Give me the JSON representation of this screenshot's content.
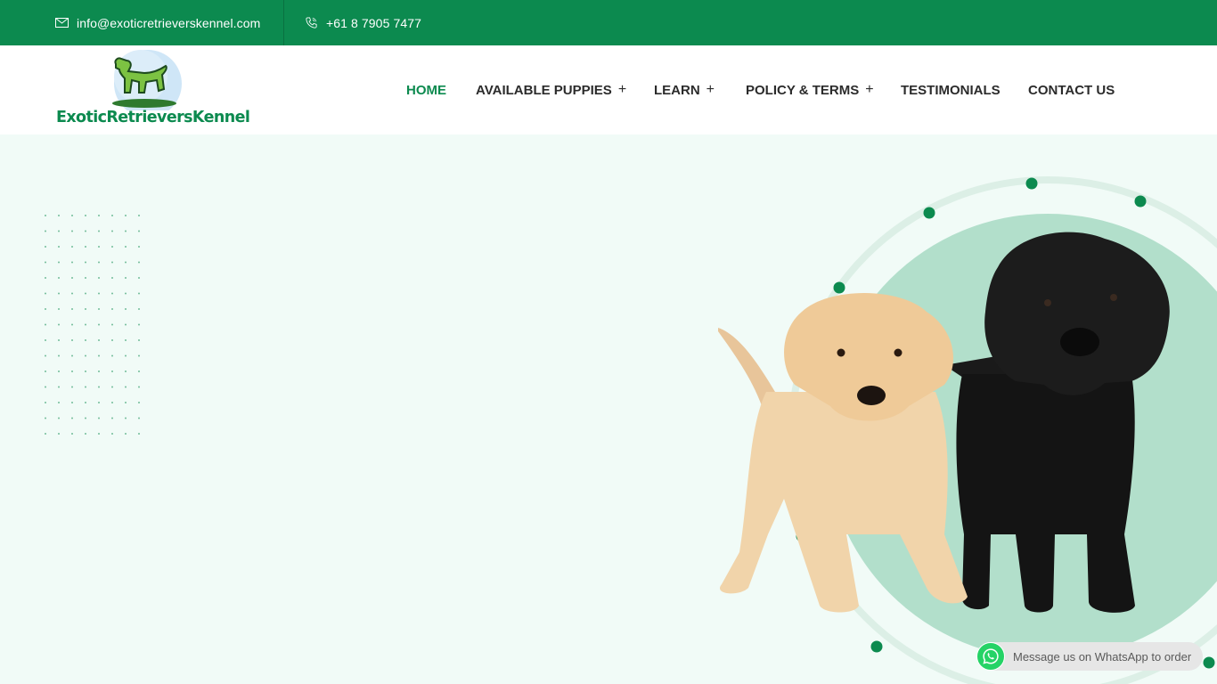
{
  "topbar": {
    "email": "info@exoticretrieverskennel.com",
    "phone": "+61 8 7905 7477",
    "email_icon": "envelope-icon",
    "phone_icon": "phone-icon"
  },
  "logo": {
    "text": "ExoticRetrieversKennel",
    "icon": "dog-logo-icon"
  },
  "nav": {
    "items": [
      {
        "label": "HOME",
        "active": true,
        "has_submenu": false
      },
      {
        "label": "AVAILABLE PUPPIES",
        "active": false,
        "has_submenu": true
      },
      {
        "label": "LEARN",
        "active": false,
        "has_submenu": true
      },
      {
        "label": "POLICY & TERMS",
        "active": false,
        "has_submenu": true
      },
      {
        "label": "TESTIMONIALS",
        "active": false,
        "has_submenu": false
      },
      {
        "label": "CONTACT US",
        "active": false,
        "has_submenu": false
      }
    ],
    "plus_symbol": "+"
  },
  "hero": {
    "image": "two-labrador-puppies-image"
  },
  "whatsapp": {
    "label": "Message us on WhatsApp to order",
    "icon": "whatsapp-icon"
  },
  "colors": {
    "brand_green": "#0c8a4f",
    "hero_bg": "#f1fbf7",
    "circle_green": "#b2dfcb"
  }
}
